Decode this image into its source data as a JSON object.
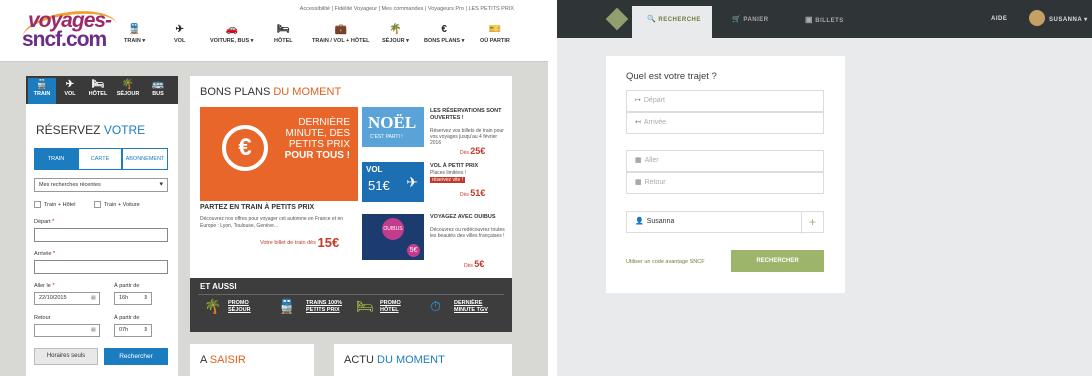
{
  "left": {
    "utility_links": "Accessibilité  |  Fidélité Voyageur  |  Mes commandes  |  Voyageurs Pro  |  LES PETITS PRIX",
    "logo": {
      "line1": "voyages-",
      "line2": "sncf.com"
    },
    "nav": [
      {
        "label": "TRAIN ▾",
        "icon": "train-icon",
        "glyph": "🚆"
      },
      {
        "label": "VOL",
        "icon": "plane-icon",
        "glyph": "✈"
      },
      {
        "label": "VOITURE, BUS ▾",
        "icon": "car-icon",
        "glyph": "🚗"
      },
      {
        "label": "HÔTEL",
        "icon": "bed-icon",
        "glyph": "🛏"
      },
      {
        "label": "TRAIN / VOL + HÔTEL",
        "icon": "suitcase-icon",
        "glyph": "💼"
      },
      {
        "label": "SÉJOUR ▾",
        "icon": "palm-icon",
        "glyph": "🌴"
      },
      {
        "label": "BONS PLANS ▾",
        "icon": "euro-icon",
        "glyph": "€"
      },
      {
        "label": "OÙ PARTIR",
        "icon": "ticket-icon",
        "glyph": "🎫"
      }
    ],
    "modes": [
      {
        "label": "TRAIN",
        "glyph": "🚆"
      },
      {
        "label": "VOL",
        "glyph": "✈"
      },
      {
        "label": "HÔTEL",
        "glyph": "🛏"
      },
      {
        "label": "SÉJOUR",
        "glyph": "🌴"
      },
      {
        "label": "BUS",
        "glyph": "🚌"
      }
    ],
    "reservez": {
      "part1": "RÉSERVEZ ",
      "part2": "VOTRE"
    },
    "tabs": [
      "TRAIN",
      "CARTE",
      "ABONNEMENT"
    ],
    "recent_select": "Mes recherches récentes",
    "checks": [
      "Train + Hôtel",
      "Train + Voiture"
    ],
    "depart_label": "Départ",
    "arrivee_label": "Arrivée",
    "aller_label": "Aller le",
    "aller_date": "22/10/2015",
    "a_partir_label": "À partir de",
    "aller_time": "16h",
    "retour_label": "Retour",
    "retour_a_partir_label": "À partir de",
    "retour_time": "07h",
    "btn_horaires": "Horaires seuls",
    "btn_rechercher": "Rechercher",
    "bons": {
      "title1": "BONS PLANS ",
      "title2": "DU MOMENT"
    },
    "promo": {
      "line1": "DERNIÈRE MINUTE,",
      "line2": "DES PETITS PRIX ",
      "bold": "POUR TOUS !"
    },
    "partez_title": "PARTEZ EN TRAIN À PETITS PRIX",
    "partez_desc": "Découvrez nos offres pour voyager cet automne en France et en Europe : Lyon, Toulouse, Genève...",
    "votre_billet": "Votre billet de train dès",
    "votre_price": "15€",
    "side": [
      {
        "title": "LES RÉSERVATIONS SONT OUVERTES !",
        "desc": "Réservez vos billets de train pour vos voyages jusqu'au 4 février 2016",
        "price_pre": "Dès",
        "price": "25€",
        "img_text": "NOËL",
        "img_sub": "C'EST PARTI !"
      },
      {
        "title": "VOL À PETIT PRIX",
        "desc": "Places limitées !",
        "badge": "réservez vite !",
        "price_pre": "Dès",
        "price": "51€",
        "img_text": "VOL",
        "img_sub": "51€"
      },
      {
        "title": "VOYAGEZ AVEC OUIBUS",
        "desc": "Découvrez ou redécouvrez toutes les beautés des villes françaises !",
        "price_pre": "Dès",
        "price": "5€",
        "img_text": "OUIBUS",
        "img_sub": "5€"
      }
    ],
    "et_aussi": "ET AUSSI",
    "aussi_items": [
      {
        "label": "PROMO SÉJOUR",
        "glyph": "🌴"
      },
      {
        "label": "TRAINS 100% PETITS PRIX",
        "glyph": "🚆"
      },
      {
        "label": "PROMO HÔTEL",
        "glyph": "🛏"
      },
      {
        "label": "DERNIÈRE MINUTE TGV",
        "glyph": "⏱"
      }
    ],
    "a_saisir": {
      "part1": "A ",
      "part2": "SAISIR"
    },
    "actu": {
      "part1": "ACTU ",
      "part2": "DU MOMENT"
    }
  },
  "right": {
    "tabs": [
      {
        "label": "RECHERCHE",
        "glyph": "🔍"
      },
      {
        "label": "PANIER",
        "glyph": "🛒"
      },
      {
        "label": "BILLETS",
        "glyph": "▣"
      }
    ],
    "aide": "AIDE",
    "user": "SUSANNA ▾",
    "question": "Quel est votre trajet ?",
    "depart_placeholder": "Départ",
    "arrivee_placeholder": "Arrivée",
    "aller_placeholder": "Aller",
    "retour_placeholder": "Retour",
    "passenger": "Susanna",
    "plus": "+",
    "code_link": "Utiliser un code avantage SNCF",
    "btn_rechercher": "RECHERCHER"
  },
  "colors": {
    "sncf_blue": "#1b7dc0",
    "orange": "#e8662a",
    "dark_nav": "#2f3437",
    "green": "#9cb56a"
  }
}
